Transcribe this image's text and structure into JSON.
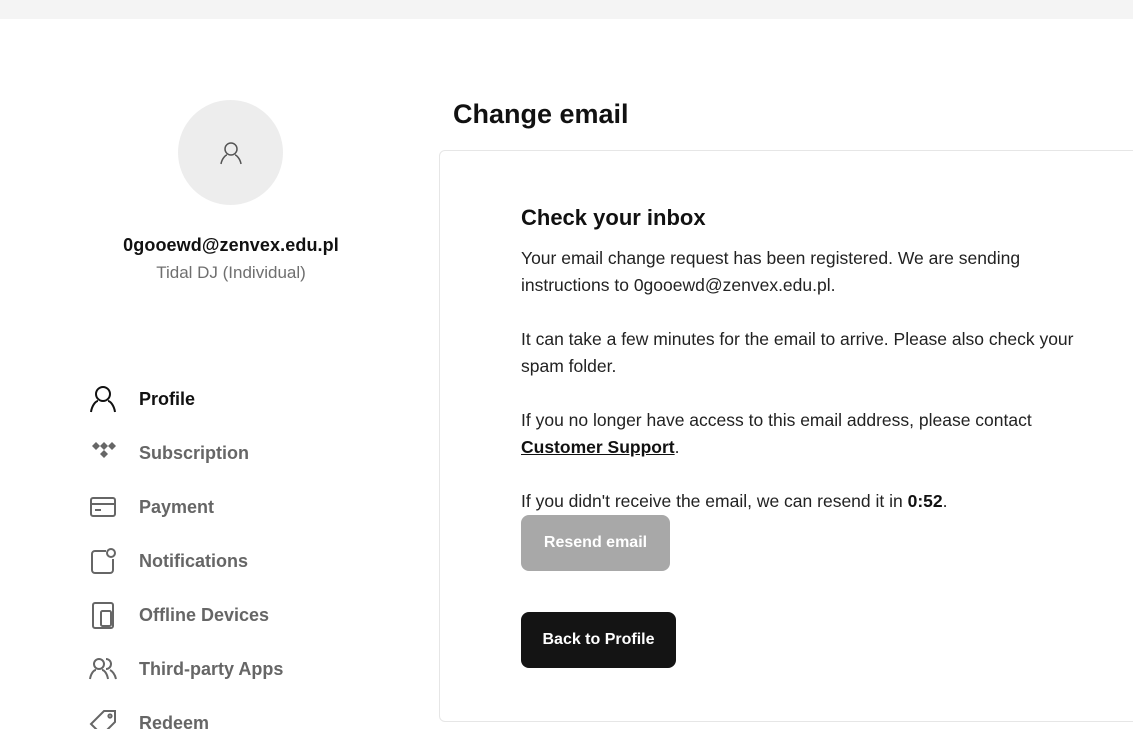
{
  "user": {
    "email": "0gooewd@zenvex.edu.pl",
    "plan": "Tidal DJ (Individual)"
  },
  "sidebar": {
    "items": [
      {
        "label": "Profile",
        "icon": "user-icon",
        "active": true
      },
      {
        "label": "Subscription",
        "icon": "tidal-logo-icon",
        "active": false
      },
      {
        "label": "Payment",
        "icon": "credit-card-icon",
        "active": false
      },
      {
        "label": "Notifications",
        "icon": "notification-icon",
        "active": false
      },
      {
        "label": "Offline Devices",
        "icon": "devices-icon",
        "active": false
      },
      {
        "label": "Third-party Apps",
        "icon": "users-icon",
        "active": false
      },
      {
        "label": "Redeem",
        "icon": "tag-icon",
        "active": false
      }
    ]
  },
  "main": {
    "title": "Change email",
    "card": {
      "heading": "Check your inbox",
      "para1": "Your email change request has been registered. We are sending instructions to 0gooewd@zenvex.edu.pl.",
      "para2": "It can take a few minutes for the email to arrive. Please also check your spam folder.",
      "para3_prefix": "If you no longer have access to this email address, please contact ",
      "para3_link": "Customer Support",
      "para3_suffix": ".",
      "para4_prefix": "If you didn't receive the email, we can resend it in ",
      "timer": "0:52",
      "para4_suffix": ".",
      "resend_label": "Resend email",
      "back_label": "Back to Profile"
    }
  },
  "colors": {
    "primary_button": "#141414",
    "disabled_button": "#a8a8a8",
    "muted_text": "#6f6f6f"
  }
}
